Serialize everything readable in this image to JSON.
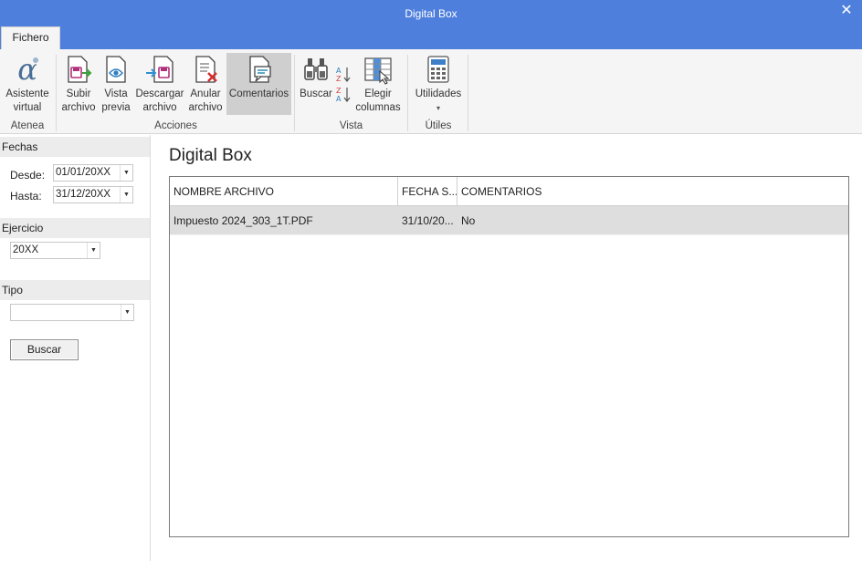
{
  "window": {
    "title": "Digital Box",
    "close_glyph": "✕"
  },
  "tabs": [
    {
      "label": "Fichero"
    }
  ],
  "ribbon": {
    "groups": [
      {
        "label": "Atenea"
      },
      {
        "label": "Acciones"
      },
      {
        "label": "Vista"
      },
      {
        "label": "Útiles"
      }
    ],
    "buttons": {
      "asistente": {
        "line1": "Asistente",
        "line2": "virtual",
        "icon": "alpha-icon"
      },
      "subir": {
        "line1": "Subir",
        "line2": "archivo",
        "icon": "upload-file-icon"
      },
      "vista_previa": {
        "line1": "Vista",
        "line2": "previa",
        "icon": "preview-icon"
      },
      "descargar": {
        "line1": "Descargar",
        "line2": "archivo",
        "icon": "download-file-icon"
      },
      "anular": {
        "line1": "Anular",
        "line2": "archivo",
        "icon": "cancel-file-icon"
      },
      "comentarios": {
        "line1": "Comentarios",
        "icon": "comments-icon"
      },
      "buscar": {
        "line1": "Buscar",
        "icon": "binoculars-icon"
      },
      "sort_az": {
        "icon": "sort-az-icon"
      },
      "sort_za": {
        "icon": "sort-za-icon"
      },
      "elegir_columnas": {
        "line1": "Elegir",
        "line2": "columnas",
        "icon": "columns-icon"
      },
      "utilidades": {
        "line1": "Utilidades",
        "line2": "▾",
        "icon": "calculator-icon"
      }
    }
  },
  "filters": {
    "fechas": {
      "header": "Fechas",
      "desde_label": "Desde:",
      "desde_value": "01/01/20XX",
      "hasta_label": "Hasta:",
      "hasta_value": "31/12/20XX"
    },
    "ejercicio": {
      "header": "Ejercicio",
      "value": "20XX"
    },
    "tipo": {
      "header": "Tipo",
      "value": ""
    },
    "buscar_label": "Buscar"
  },
  "main": {
    "title": "Digital Box",
    "columns": [
      "NOMBRE ARCHIVO",
      "FECHA S...",
      "COMENTARIOS"
    ],
    "rows": [
      {
        "nombre": "Impuesto 2024_303_1T.PDF",
        "fecha": "31/10/20...",
        "comentarios": "No"
      }
    ]
  },
  "colors": {
    "titlebar": "#4e7fdc",
    "ribbon_bg": "#f5f5f5",
    "active_button": "#cfcfcf",
    "selected_row": "#dedede"
  }
}
